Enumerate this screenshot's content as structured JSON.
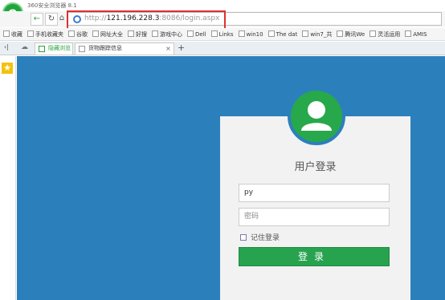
{
  "browser": {
    "title": "360安全浏览器 8.1",
    "address": {
      "scheme": "http://",
      "host": "121.196.228.3",
      "rest": ":8086/login.aspx"
    }
  },
  "bookmarks": [
    "收藏",
    "手机收藏夹",
    "谷歌",
    "网址大全",
    "好搜",
    "游戏中心",
    "Dell",
    "Links",
    "win10",
    "The dat",
    "win7_共",
    "腾讯We",
    "灵活运用",
    "AMIS"
  ],
  "tabs": [
    {
      "label": "隐藏浏览"
    },
    {
      "label": "货物跟踪信息"
    }
  ],
  "login": {
    "title": "用户登录",
    "username_value": "py",
    "password_placeholder": "密码",
    "remember_label": "记住登录",
    "submit_label": "登录"
  },
  "colors": {
    "page_bg": "#2b80bc",
    "accent": "#27a84a",
    "highlight": "#e03030"
  }
}
